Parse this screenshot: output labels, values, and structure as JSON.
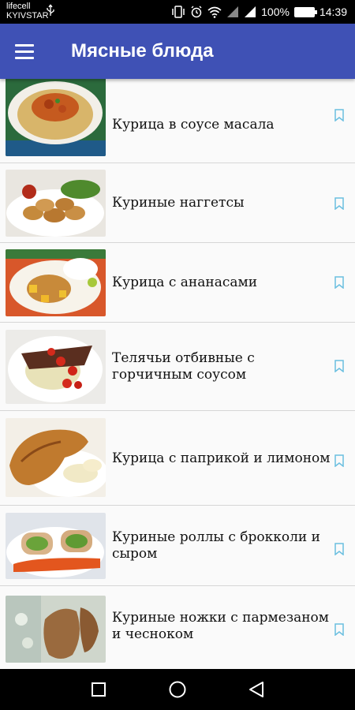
{
  "status": {
    "carrier_1": "lifecell",
    "carrier_2": "KYIVSTAR",
    "battery": "100%",
    "time": "14:39"
  },
  "app_bar": {
    "title": "Мясные блюда"
  },
  "recipes": [
    {
      "title": "Курица в соусе масала"
    },
    {
      "title": "Куриные наггетсы"
    },
    {
      "title": "Курица с ананасами"
    },
    {
      "title": "Телячьи отбивные с горчичным соусом"
    },
    {
      "title": "Курица с паприкой и лимоном"
    },
    {
      "title": "Куриные роллы с брокколи и сыром"
    },
    {
      "title": "Куриные ножки с пармезаном и чесноком"
    }
  ],
  "icons": {
    "menu": "hamburger-icon",
    "bookmark": "bookmark-icon",
    "nav_home": "circle-home-icon",
    "nav_back": "triangle-back-icon",
    "nav_recents": "square-recents-icon"
  },
  "colors": {
    "app_bar": "#3f51b5",
    "bookmark": "#6bbfe0",
    "list_bg": "#fafafa"
  }
}
